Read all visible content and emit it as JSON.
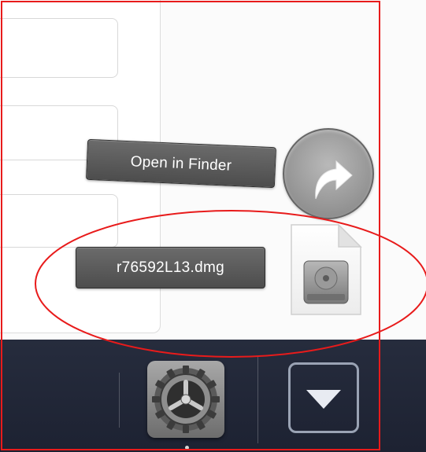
{
  "tooltips": {
    "open_in_finder": "Open in Finder",
    "downloaded_file": "r76592L13.dmg"
  },
  "icons": {
    "finder_button": "open-in-finder-arrow-icon",
    "file": "dmg-file-icon",
    "dock_app": "system-preferences-gear-icon",
    "dock_stack": "chevron-down-icon"
  },
  "colors": {
    "annotation": "#e81b1b",
    "dock": "#232939",
    "tooltip": "#5a5a5a"
  }
}
